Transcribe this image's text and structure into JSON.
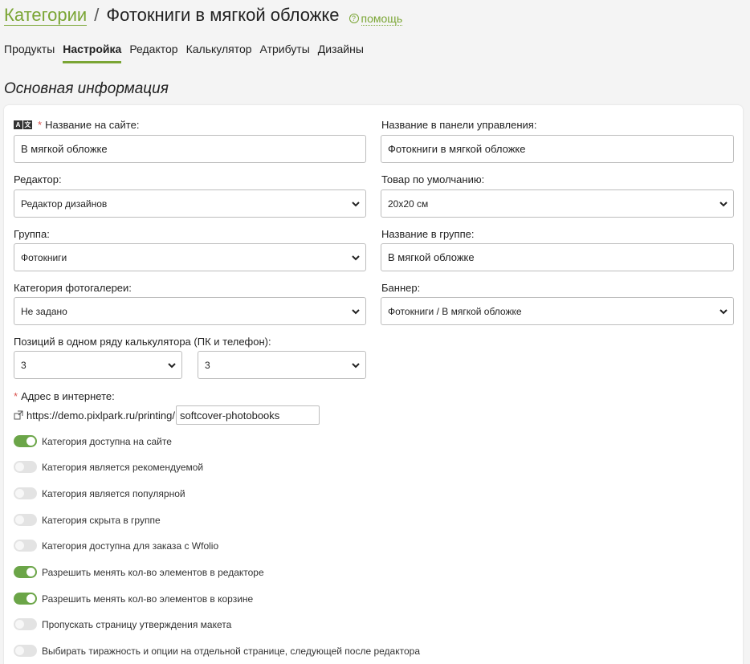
{
  "header": {
    "breadcrumb_link": "Категории",
    "separator": "/",
    "title": "Фотокниги в мягкой обложке",
    "help_label": "помощь"
  },
  "tabs": [
    {
      "label": "Продукты",
      "active": false
    },
    {
      "label": "Настройка",
      "active": true
    },
    {
      "label": "Редактор",
      "active": false
    },
    {
      "label": "Калькулятор",
      "active": false
    },
    {
      "label": "Атрибуты",
      "active": false
    },
    {
      "label": "Дизайны",
      "active": false
    }
  ],
  "section_title": "Основная информация",
  "form": {
    "site_name": {
      "label": "Название на сайте:",
      "value": "В мягкой обложке"
    },
    "admin_name": {
      "label": "Название в панели управления:",
      "value": "Фотокниги в мягкой обложке"
    },
    "editor": {
      "label": "Редактор:",
      "value": "Редактор дизайнов"
    },
    "default_product": {
      "label": "Товар по умолчанию:",
      "value": "20x20 см"
    },
    "group": {
      "label": "Группа:",
      "value": "Фотокниги"
    },
    "group_name": {
      "label": "Название в группе:",
      "value": "В мягкой обложке"
    },
    "gallery_category": {
      "label": "Категория фотогалереи:",
      "value": "Не задано"
    },
    "banner": {
      "label": "Баннер:",
      "value": "Фотокниги / В мягкой обложке"
    },
    "positions": {
      "label": "Позиций в одном ряду калькулятора (ПК и телефон):",
      "pc_value": "3",
      "phone_value": "3"
    },
    "url": {
      "label": "Адрес в интернете:",
      "prefix": "https://demo.pixlpark.ru/printing/",
      "slug": "softcover-photobooks"
    }
  },
  "toggles": [
    {
      "label": "Категория доступна на сайте",
      "on": true
    },
    {
      "label": "Категория является рекомендуемой",
      "on": false
    },
    {
      "label": "Категория является популярной",
      "on": false
    },
    {
      "label": "Категория скрыта в группе",
      "on": false
    },
    {
      "label": "Категория доступна для заказа с Wfolio",
      "on": false
    },
    {
      "label": "Разрешить менять кол-во элементов в редакторе",
      "on": true
    },
    {
      "label": "Разрешить менять кол-во элементов в корзине",
      "on": true
    },
    {
      "label": "Пропускать страницу утверждения макета",
      "on": false
    },
    {
      "label": "Выбирать тиражность и опции на отдельной странице, следующей после редактора",
      "on": false
    }
  ],
  "colors": {
    "accent": "#7aa534",
    "toggle_on": "#6ba548",
    "required": "#d9534f"
  }
}
